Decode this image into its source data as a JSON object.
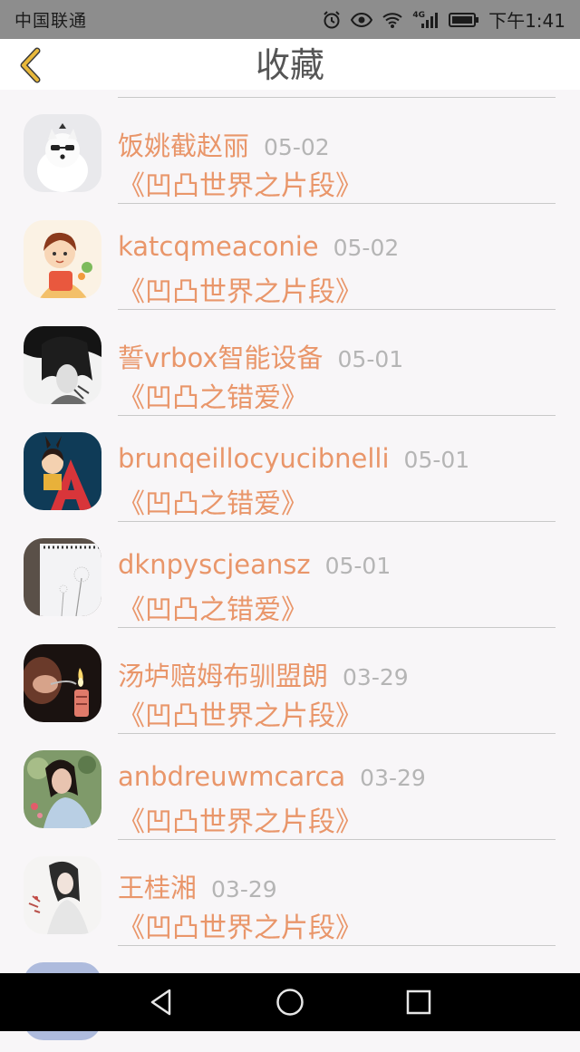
{
  "status_bar": {
    "carrier": "中国联通",
    "network": "4G",
    "time": "下午1:41"
  },
  "header": {
    "title": "收藏"
  },
  "items": [
    {
      "name": "饭姚截赵丽",
      "date": "05-02",
      "work": "《凹凸世界之片段》",
      "avatar": "avatar-white-dog"
    },
    {
      "name": "katcqmeaconie",
      "date": "05-02",
      "work": "《凹凸世界之片段》",
      "avatar": "avatar-cartoon-girl"
    },
    {
      "name": "誓vrbox智能设备",
      "date": "05-01",
      "work": "《凹凸之错爱》",
      "avatar": "avatar-dark-hair-portrait"
    },
    {
      "name": "brunqeillocyucibnelli",
      "date": "05-01",
      "work": "《凹凸之错爱》",
      "avatar": "avatar-letter-a-character"
    },
    {
      "name": "dknpyscjeansz",
      "date": "05-01",
      "work": "《凹凸之错爱》",
      "avatar": "avatar-dandelion-notebook"
    },
    {
      "name": "汤垆赔姆布驯盟朗",
      "date": "03-29",
      "work": "《凹凸世界之片段》",
      "avatar": "avatar-lighter-flame"
    },
    {
      "name": "anbdreuwmcarca",
      "date": "03-29",
      "work": "《凹凸世界之片段》",
      "avatar": "avatar-woman-photo"
    },
    {
      "name": "王桂湘",
      "date": "03-29",
      "work": "《凹凸世界之片段》",
      "avatar": "avatar-ink-painting-lady"
    }
  ],
  "colors": {
    "accent": "#e9966a",
    "date": "#b5b5b5",
    "back_icon": "#e8b83a"
  }
}
